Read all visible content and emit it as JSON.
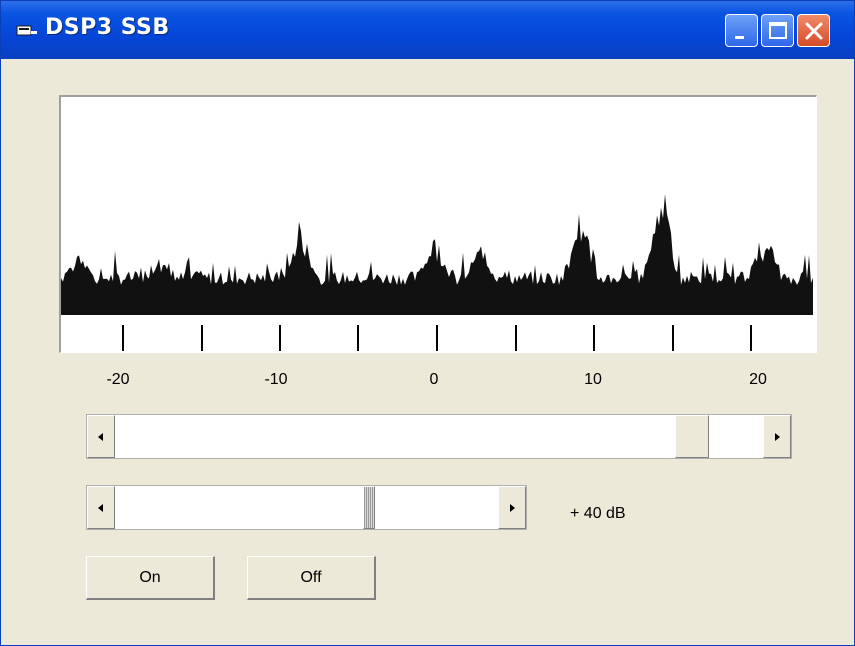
{
  "window": {
    "title": "DSP3  SSB"
  },
  "titlebar_buttons": [
    "minimize-icon",
    "maximize-icon",
    "close-icon"
  ],
  "spectrum": {
    "axis_labels": [
      "-20",
      "-10",
      "0",
      "10",
      "20"
    ],
    "background_color": "#ffffff",
    "trace_color": "#111111"
  },
  "frequency_scrollbar": {
    "position": 0.87
  },
  "gain_scrollbar": {
    "position": 0.65
  },
  "gain_label": "+ 40 dB",
  "buttons": {
    "on_label": "On",
    "off_label": "Off"
  }
}
